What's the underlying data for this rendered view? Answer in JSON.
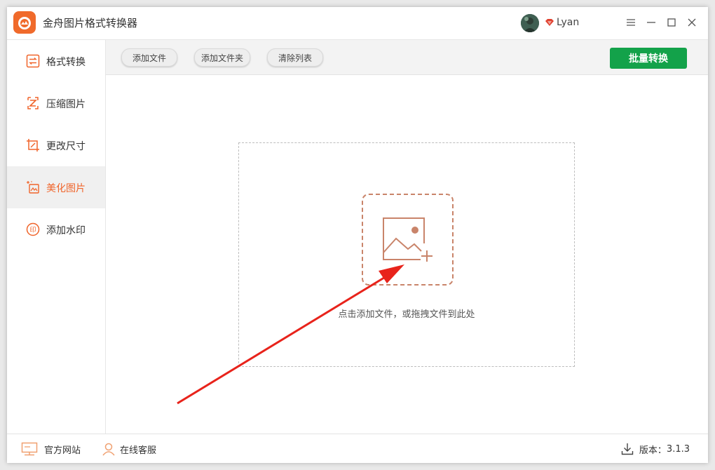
{
  "app": {
    "title": "金舟图片格式转换器"
  },
  "user": {
    "name": "Lyan"
  },
  "sidebar": {
    "items": [
      {
        "label": "格式转换",
        "icon": "swap-icon",
        "active": false
      },
      {
        "label": "压缩图片",
        "icon": "compress-icon",
        "active": false
      },
      {
        "label": "更改尺寸",
        "icon": "crop-icon",
        "active": false
      },
      {
        "label": "美化图片",
        "icon": "beautify-icon",
        "active": true
      },
      {
        "label": "添加水印",
        "icon": "stamp-icon",
        "active": false
      }
    ]
  },
  "toolbar": {
    "add_file": "添加文件",
    "add_folder": "添加文件夹",
    "clear_list": "清除列表",
    "batch_convert": "批量转换"
  },
  "main": {
    "drop_hint": "点击添加文件，或拖拽文件到此处"
  },
  "footer": {
    "website": "官方网站",
    "support": "在线客服",
    "version_label": "版本：",
    "version": "3.1.3"
  },
  "colors": {
    "accent": "#f0642a",
    "batch_button": "#13a24a",
    "annotation_arrow": "#e8231b",
    "dashed_box": "#c9846a"
  }
}
